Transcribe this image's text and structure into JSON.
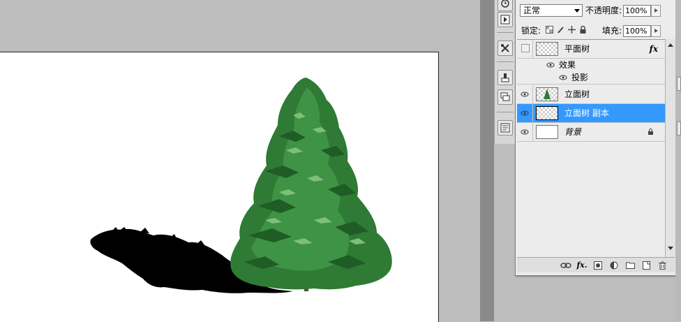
{
  "canvas": {
    "description_layers": [
      "平面树",
      "立面树",
      "立面树 副本",
      "背景"
    ]
  },
  "layers_panel": {
    "blend_mode": "正常",
    "opacity_label": "不透明度:",
    "opacity_value": "100%",
    "lock_label": "锁定:",
    "fill_label": "填充:",
    "fill_value": "100%",
    "layers": [
      {
        "name": "平面树",
        "visible": false,
        "fx": "fx",
        "selected": false
      },
      {
        "name": "效果",
        "type": "effects-group"
      },
      {
        "name": "投影",
        "type": "effect"
      },
      {
        "name": "立面树",
        "visible": true,
        "selected": false
      },
      {
        "name": "立面树 副本",
        "visible": true,
        "selected": true
      },
      {
        "name": "背景",
        "visible": true,
        "locked": true,
        "selected": false
      }
    ],
    "footer_icons": [
      "link-icon",
      "fx-icon",
      "mask-icon",
      "adjustment-icon",
      "folder-icon",
      "new-layer-icon",
      "trash-icon"
    ],
    "footer_fx": "fx."
  },
  "tool_dock": {
    "icons": [
      "history-icon",
      "actions-icon",
      "tools-preset-icon",
      "clone-source-icon",
      "layer-comps-icon",
      "notes-icon"
    ]
  },
  "colors": {
    "selection": "#3399ff",
    "panel_bg": "#ececec",
    "workspace_bg": "#bdbdbd",
    "tree_green": "#2f7a34"
  }
}
